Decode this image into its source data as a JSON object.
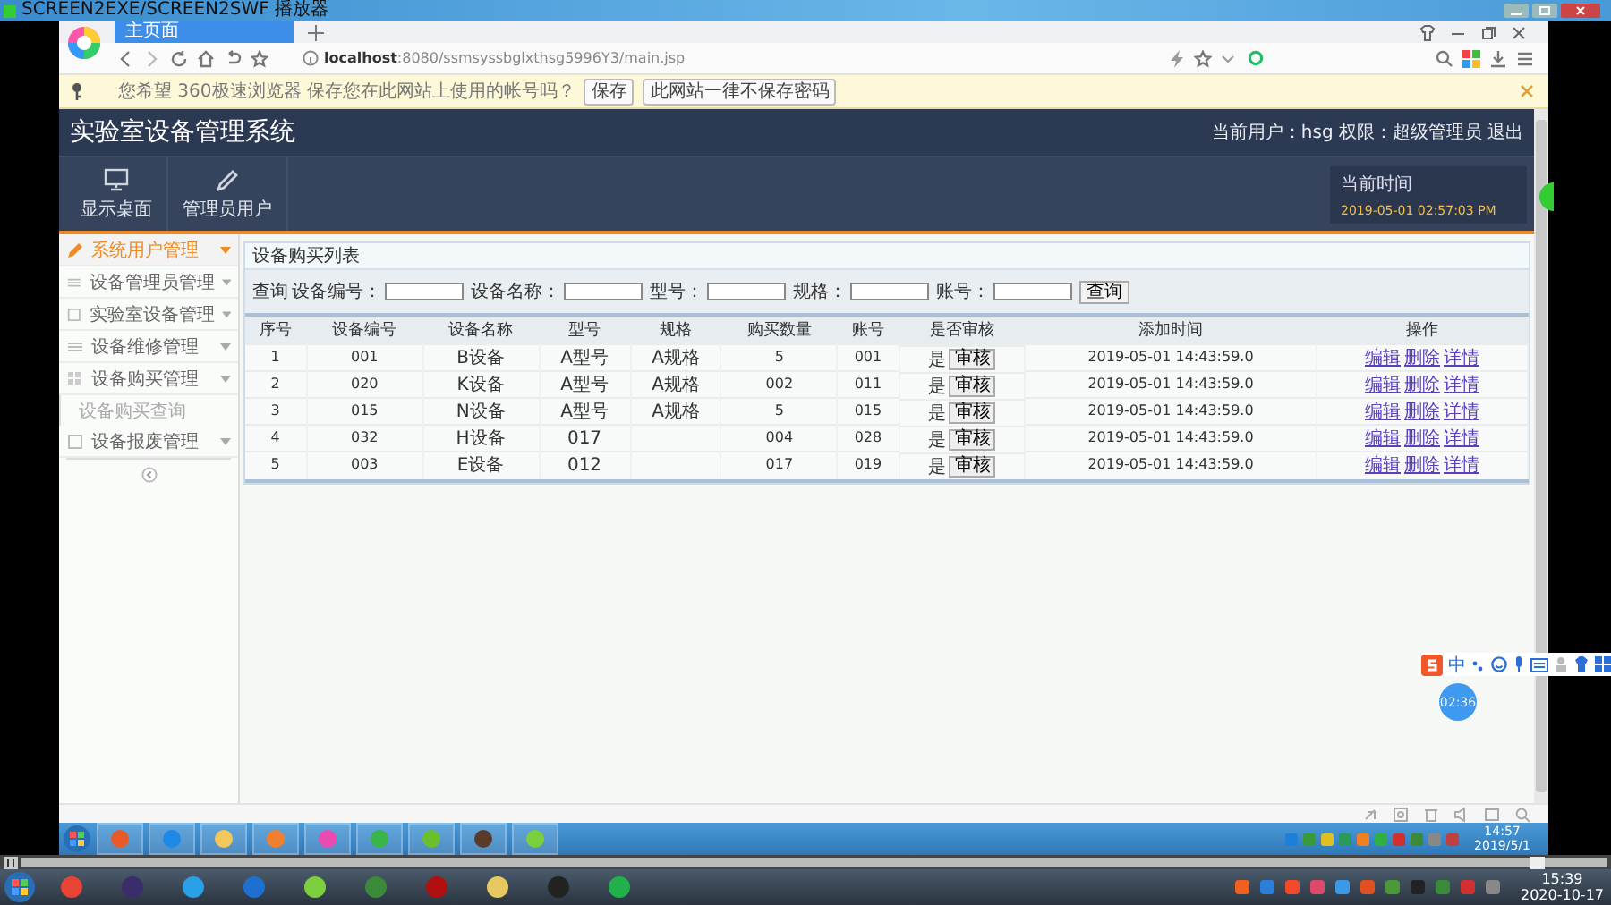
{
  "player": {
    "title": "SCREEN2EXE/SCREEN2SWF 播放器"
  },
  "browser": {
    "tabs": [
      {
        "label": "主页面",
        "selected": true
      }
    ],
    "address": {
      "host": "localhost",
      "path": ":8080/ssmsyssbglxthsg5996Y3/main.jsp"
    },
    "password_bar": {
      "message": "您希望 360极速浏览器 保存您在此网站上使用的帐号吗？",
      "buttons": [
        "保存",
        "此网站一律不保存密码"
      ]
    }
  },
  "app": {
    "title": "实验室设备管理系统",
    "user_info": "当前用户：hsg 权限：超级管理员",
    "logout": "退出",
    "nav": [
      {
        "label": "显示桌面",
        "kind": "monitor"
      },
      {
        "label": "管理员用户",
        "kind": "pen"
      }
    ],
    "clock": {
      "label": "当前时间",
      "value": "2019-05-01 02:57:03 PM"
    }
  },
  "sidebar": {
    "items": [
      {
        "label": "系统用户管理",
        "selected": true,
        "kind": "pen"
      },
      {
        "label": "设备管理员管理",
        "selected": false,
        "kind": "list"
      },
      {
        "label": "实验室设备管理",
        "selected": false,
        "kind": "page"
      },
      {
        "label": "设备维修管理",
        "selected": false,
        "kind": "list"
      },
      {
        "label": "设备购买管理",
        "selected": false,
        "kind": "grid",
        "children": [
          {
            "label": "设备购买查询"
          }
        ]
      },
      {
        "label": "设备报废管理",
        "selected": false,
        "kind": "page"
      }
    ]
  },
  "panel": {
    "title": "设备购买列表",
    "search": {
      "label": "查询",
      "fields": [
        {
          "label": "设备编号："
        },
        {
          "label": "设备名称："
        },
        {
          "label": "型号："
        },
        {
          "label": "规格："
        },
        {
          "label": "账号："
        }
      ],
      "button": "查询"
    },
    "table": {
      "columns": [
        "序号",
        "设备编号",
        "设备名称",
        "型号",
        "规格",
        "购买数量",
        "账号",
        "是否审核",
        "添加时间",
        "操作"
      ],
      "rows": [
        {
          "cells": [
            "1",
            "001",
            "B设备",
            "A型号",
            "A规格",
            "5",
            "001"
          ],
          "approved": "是",
          "review": "审核",
          "added": "2019-05-01 14:43:59.0",
          "actions": [
            "编辑",
            "删除",
            "详情"
          ]
        },
        {
          "cells": [
            "2",
            "020",
            "K设备",
            "A型号",
            "A规格",
            "002",
            "011"
          ],
          "approved": "是",
          "review": "审核",
          "added": "2019-05-01 14:43:59.0",
          "actions": [
            "编辑",
            "删除",
            "详情"
          ]
        },
        {
          "cells": [
            "3",
            "015",
            "N设备",
            "A型号",
            "A规格",
            "5",
            "015"
          ],
          "approved": "是",
          "review": "审核",
          "added": "2019-05-01 14:43:59.0",
          "actions": [
            "编辑",
            "删除",
            "详情"
          ]
        },
        {
          "cells": [
            "4",
            "032",
            "H设备",
            "017",
            "",
            "004",
            "028"
          ],
          "approved": "是",
          "review": "审核",
          "added": "2019-05-01 14:43:59.0",
          "actions": [
            "编辑",
            "删除",
            "详情"
          ]
        },
        {
          "cells": [
            "5",
            "003",
            "E设备",
            "012",
            "",
            "017",
            "019"
          ],
          "approved": "是",
          "review": "审核",
          "added": "2019-05-01 14:43:59.0",
          "actions": [
            "编辑",
            "删除",
            "详情"
          ]
        }
      ]
    }
  },
  "ime": {
    "mode": "中"
  },
  "timer": "02:36",
  "seek": {
    "level": 0.96
  },
  "inner_taskbar": {
    "time": "14:57",
    "date": "2019/5/1"
  },
  "host_taskbar": {
    "time": "15:39",
    "date": "2020-10-17"
  }
}
